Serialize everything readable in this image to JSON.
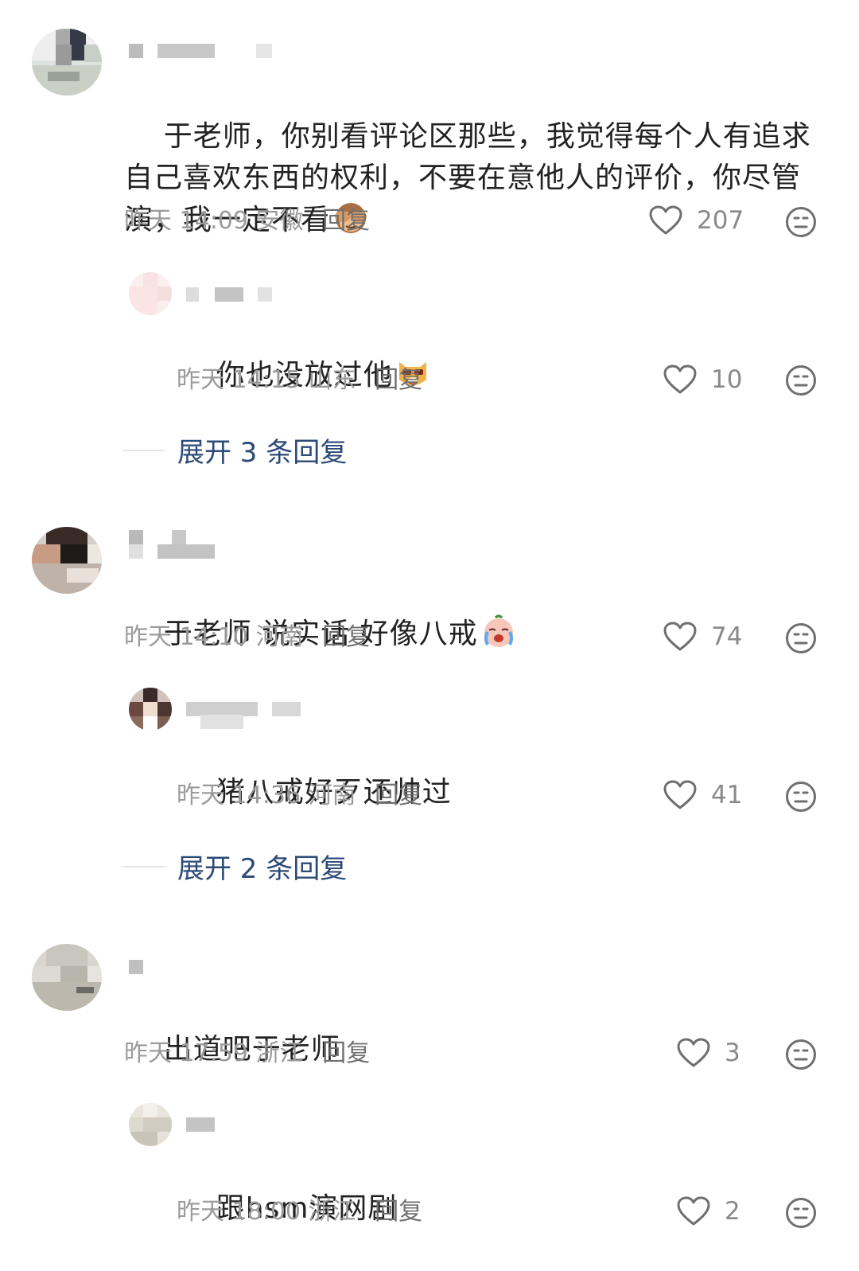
{
  "comments": [
    {
      "text": "于老师，你别看评论区那些，我觉得每个人有追求自己喜欢东西的权利，不要在意他人的评价，你尽管演，我一定不看",
      "emoji": "see-no-evil-monkey",
      "time": "昨天 14:09",
      "location": "安徽",
      "reply_label": "回复",
      "likes": "207",
      "reply": {
        "text": "你也没放过他",
        "emoji": "sunglasses-dog",
        "time": "昨天 14:15",
        "location": "山东",
        "reply_label": "回复",
        "likes": "10"
      },
      "expand_label": "展开 3 条回复"
    },
    {
      "text": "于老师 说实话 好像八戒",
      "emoji": "crying-face",
      "time": "昨天 14:10",
      "location": "河南",
      "reply_label": "回复",
      "likes": "74",
      "reply": {
        "text": "猪八戒好歹还帅过",
        "time": "昨天 14:36",
        "location": "河南",
        "reply_label": "回复",
        "likes": "41"
      },
      "expand_label": "展开 2 条回复"
    },
    {
      "text": "出道吧于老师",
      "time": "昨天 17:59",
      "location": "浙江",
      "reply_label": "回复",
      "likes": "3",
      "reply": {
        "text": "跟hsm演网剧",
        "time": "昨天 18:00",
        "location": "浙江",
        "reply_label": "回复",
        "likes": "2"
      }
    }
  ],
  "icons": {
    "like": "heart-outline-icon",
    "dislike": "meh-face-icon"
  },
  "colors": {
    "text": "#222222",
    "meta": "#9b9b9b",
    "expand": "#2c4a77",
    "icon": "#6f6f6f"
  }
}
